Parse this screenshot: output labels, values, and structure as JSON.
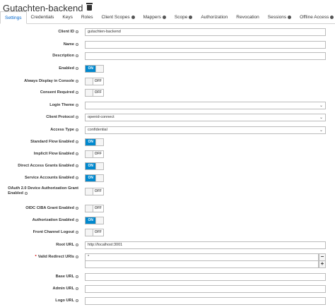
{
  "client_name": "Gutachten-backend",
  "tabs": [
    {
      "label": "Settings",
      "active": true,
      "help": false
    },
    {
      "label": "Credentials",
      "help": false
    },
    {
      "label": "Keys",
      "help": false
    },
    {
      "label": "Roles",
      "help": false
    },
    {
      "label": "Client Scopes",
      "help": true
    },
    {
      "label": "Mappers",
      "help": true
    },
    {
      "label": "Scope",
      "help": true
    },
    {
      "label": "Authorization",
      "help": false
    },
    {
      "label": "Revocation",
      "help": false
    },
    {
      "label": "Sessions",
      "help": true
    },
    {
      "label": "Offline Access",
      "help": true
    }
  ],
  "fields": {
    "client_id": {
      "label": "Client ID",
      "value": "gutachten-backend"
    },
    "name": {
      "label": "Name",
      "value": ""
    },
    "description": {
      "label": "Description",
      "value": ""
    },
    "enabled": {
      "label": "Enabled",
      "state": "ON"
    },
    "always_display": {
      "label": "Always Display in Console",
      "state": "OFF"
    },
    "consent_required": {
      "label": "Consent Required",
      "state": "OFF"
    },
    "login_theme": {
      "label": "Login Theme",
      "value": ""
    },
    "client_protocol": {
      "label": "Client Protocol",
      "value": "openid-connect"
    },
    "access_type": {
      "label": "Access Type",
      "value": "confidential"
    },
    "standard_flow": {
      "label": "Standard Flow Enabled",
      "state": "ON"
    },
    "implicit_flow": {
      "label": "Implicit Flow Enabled",
      "state": "OFF"
    },
    "direct_access": {
      "label": "Direct Access Grants Enabled",
      "state": "ON"
    },
    "service_accounts": {
      "label": "Service Accounts Enabled",
      "state": "ON"
    },
    "oauth_device": {
      "label_line1": "OAuth 2.0 Device Authorization Grant",
      "label_line2": "Enabled",
      "state": "OFF"
    },
    "oidc_ciba": {
      "label": "OIDC CIBA Grant Enabled",
      "state": "OFF"
    },
    "authorization": {
      "label": "Authorization Enabled",
      "state": "ON"
    },
    "front_channel": {
      "label": "Front Channel Logout",
      "state": "OFF"
    },
    "root_url": {
      "label": "Root URL",
      "value": "http://localhost:3001"
    },
    "valid_redirect": {
      "label": "Valid Redirect URIs",
      "value": "*",
      "remove": "−",
      "add": "+"
    },
    "base_url": {
      "label": "Base URL",
      "value": ""
    },
    "admin_url": {
      "label": "Admin URL",
      "value": ""
    },
    "logo_url": {
      "label": "Logo URL",
      "value": ""
    }
  },
  "icons": {
    "trash": "trash-icon",
    "help": "help-icon",
    "chevron": "chevron-down-icon"
  }
}
